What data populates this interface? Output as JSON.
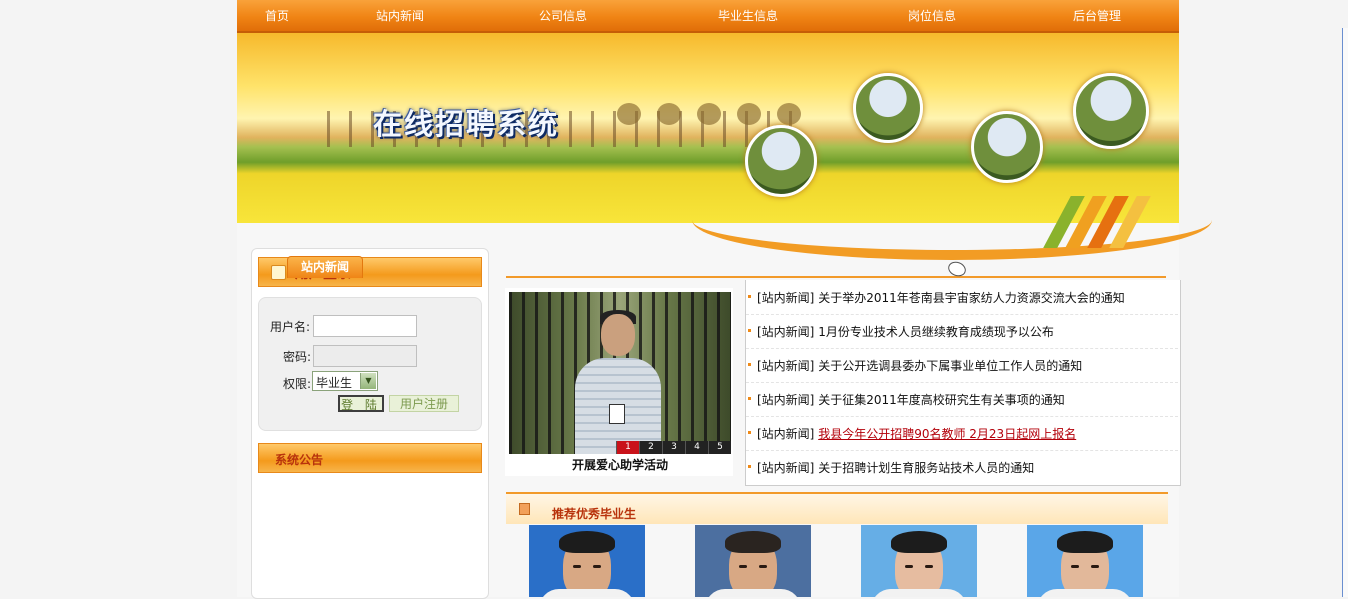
{
  "nav": {
    "items": [
      "首页",
      "站内新闻",
      "公司信息",
      "毕业生信息",
      "岗位信息",
      "后台管理"
    ]
  },
  "banner": {
    "title": "在线招聘系统"
  },
  "login": {
    "title": "用户登录",
    "username_label": "用户名:",
    "password_label": "密码:",
    "role_label": "权限:",
    "role_value": "毕业生",
    "login_button": "登 陆",
    "register_button": "用户注册"
  },
  "notice": {
    "title": "系统公告"
  },
  "news": {
    "tab": "站内新闻",
    "slideshow": {
      "caption": "开展爱心助学活动",
      "pages": [
        "1",
        "2",
        "3",
        "4",
        "5"
      ]
    },
    "items": [
      {
        "tag": "[站内新闻]",
        "text": "关于举办2011年苍南县宇宙家纺人力资源交流大会的通知"
      },
      {
        "tag": "[站内新闻]",
        "text": "1月份专业技术人员继续教育成绩现予以公布"
      },
      {
        "tag": "[站内新闻]",
        "text": "关于公开选调县委办下属事业单位工作人员的通知"
      },
      {
        "tag": "[站内新闻]",
        "text": "关于征集2011年度高校研究生有关事项的通知"
      },
      {
        "tag": "[站内新闻]",
        "text": "我县今年公开招聘90名教师 2月23日起网上报名"
      },
      {
        "tag": "[站内新闻]",
        "text": "关于招聘计划生育服务站技术人员的通知"
      }
    ]
  },
  "graduates": {
    "title": "推荐优秀毕业生"
  },
  "colors": {
    "accent": "#f08414",
    "heading": "#b8330c",
    "link_highlight": "#b3000a"
  }
}
